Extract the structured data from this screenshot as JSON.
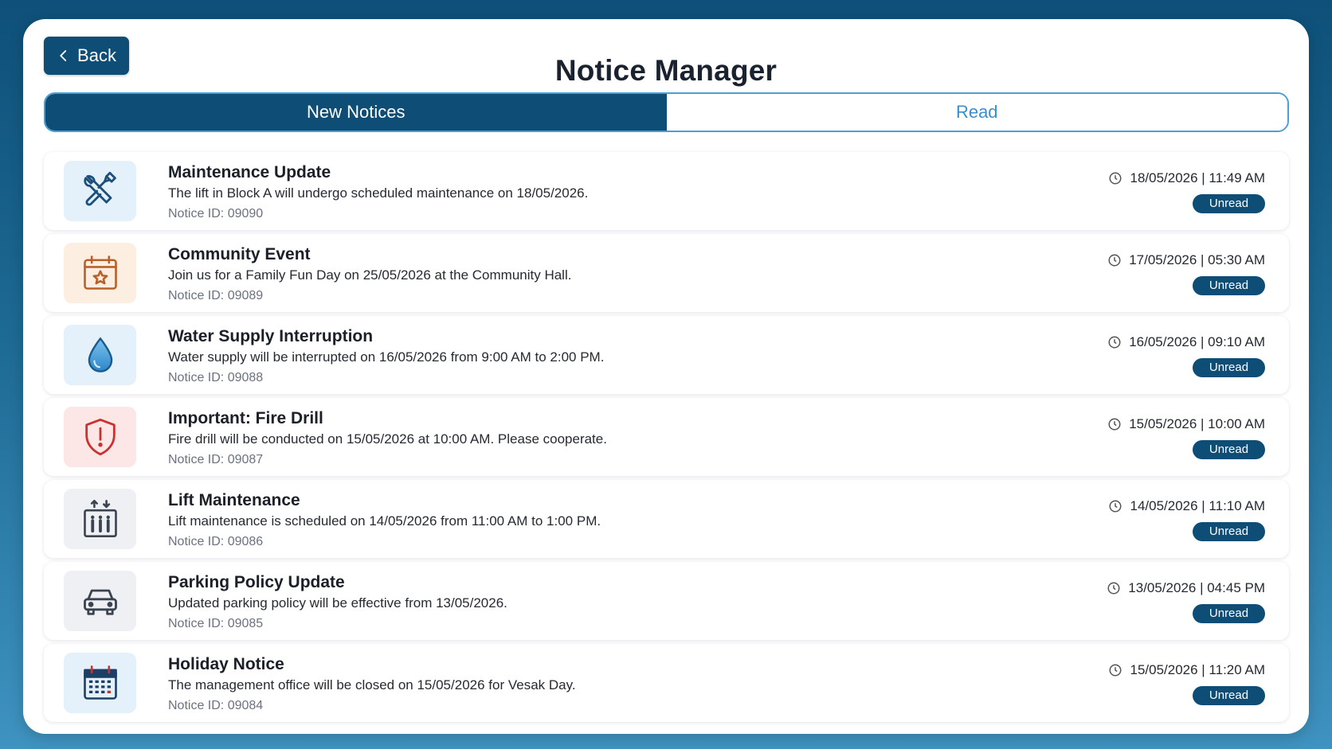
{
  "header": {
    "back_label": "Back",
    "title": "Notice Manager"
  },
  "tabs": [
    {
      "label": "New Notices",
      "active": true
    },
    {
      "label": "Read",
      "active": false
    }
  ],
  "notices": [
    {
      "icon": "tools-icon",
      "title": "Maintenance Update",
      "description": "The lift in Block A will undergo scheduled maintenance on 18/05/2026.",
      "notice_id": "Notice ID: 09090",
      "timestamp": "18/05/2026 | 11:49 AM",
      "status": "Unread"
    },
    {
      "icon": "calendar-star-icon",
      "title": "Community Event",
      "description": "Join us for a Family Fun Day on 25/05/2026 at the Community Hall.",
      "notice_id": "Notice ID: 09089",
      "timestamp": "17/05/2026 | 05:30 AM",
      "status": "Unread"
    },
    {
      "icon": "water-drop-icon",
      "title": "Water Supply Interruption",
      "description": "Water supply will be interrupted on 16/05/2026 from 9:00 AM to 2:00 PM.",
      "notice_id": "Notice ID: 09088",
      "timestamp": "16/05/2026 | 09:10 AM",
      "status": "Unread"
    },
    {
      "icon": "shield-alert-icon",
      "title": "Important: Fire Drill",
      "description": "Fire drill will be conducted on 15/05/2026 at 10:00 AM. Please cooperate.",
      "notice_id": "Notice ID: 09087",
      "timestamp": "15/05/2026 | 10:00 AM",
      "status": "Unread"
    },
    {
      "icon": "elevator-icon",
      "title": "Lift Maintenance",
      "description": "Lift maintenance is scheduled on 14/05/2026 from 11:00 AM to 1:00 PM.",
      "notice_id": "Notice ID: 09086",
      "timestamp": "14/05/2026 | 11:10 AM",
      "status": "Unread"
    },
    {
      "icon": "car-icon",
      "title": "Parking Policy Update",
      "description": "Updated parking policy will be effective from 13/05/2026.",
      "notice_id": "Notice ID: 09085",
      "timestamp": "13/05/2026 | 04:45 PM",
      "status": "Unread"
    },
    {
      "icon": "calendar-icon",
      "title": "Holiday Notice",
      "description": "The management office will be closed on 15/05/2026 for Vesak Day.",
      "notice_id": "Notice ID: 09084",
      "timestamp": "15/05/2026 | 11:20 AM",
      "status": "Unread"
    }
  ],
  "colors": {
    "primary": "#0d4d76",
    "tab_inactive_text": "#3a8fd0",
    "background_top": "#0e5079",
    "background_bottom": "#3f93c0"
  }
}
